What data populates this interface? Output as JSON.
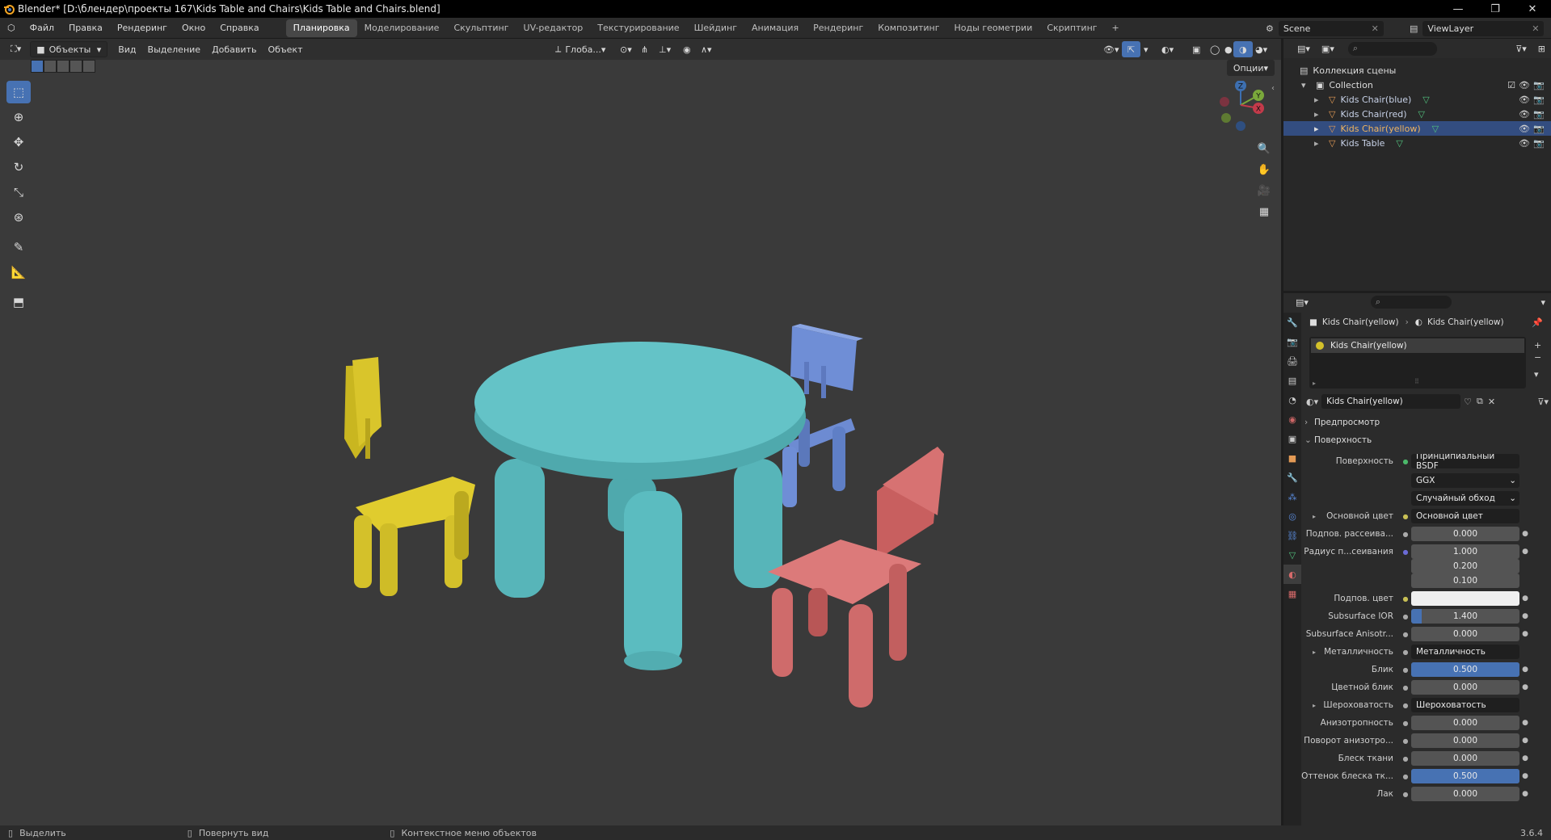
{
  "window": {
    "title": "Blender* [D:\\блендер\\проекты 167\\Kids Table and Chairs\\Kids Table and Chairs.blend]",
    "minimize": "—",
    "maximize": "❐",
    "close": "✕"
  },
  "menu": [
    "Файл",
    "Правка",
    "Рендеринг",
    "Окно",
    "Справка"
  ],
  "workspaces": [
    "Планировка",
    "Моделирование",
    "Скульптинг",
    "UV-редактор",
    "Текстурирование",
    "Шейдинг",
    "Анимация",
    "Рендеринг",
    "Композитинг",
    "Ноды геометрии",
    "Скриптинг",
    "+"
  ],
  "scene": {
    "name": "Scene",
    "view_layer": "ViewLayer"
  },
  "viewport": {
    "mode": "Объекты",
    "menus": [
      "Вид",
      "Выделение",
      "Добавить",
      "Объект"
    ],
    "transform_orientation": "Глоба...",
    "options": "Опции"
  },
  "outliner": {
    "root": "Коллекция сцены",
    "collection": "Collection",
    "items": [
      "Kids Chair(blue)",
      "Kids Chair(red)",
      "Kids Chair(yellow)",
      "Kids Table"
    ],
    "selected_index": 2
  },
  "properties": {
    "breadcrumb_object": "Kids Chair(yellow)",
    "breadcrumb_material": "Kids Chair(yellow)",
    "slot": "Kids Chair(yellow)",
    "material_name": "Kids Chair(yellow)",
    "panel_preview": "Предпросмотр",
    "panel_surface": "Поверхность",
    "surface_label": "Поверхность",
    "surface_value": "Принципиальный BSDF",
    "distribution": "GGX",
    "subsurface_method": "Случайный обход",
    "rows": [
      {
        "label": "Основной цвет",
        "value": "Основной цвет",
        "type": "link"
      },
      {
        "label": "Подпов. рассеива...",
        "value": "0.000",
        "type": "num"
      },
      {
        "label": "Радиус п...сеивания",
        "value": "1.000",
        "type": "num"
      },
      {
        "label": "",
        "value": "0.200",
        "type": "num"
      },
      {
        "label": "",
        "value": "0.100",
        "type": "num"
      },
      {
        "label": "Подпов. цвет",
        "value": "",
        "type": "color"
      },
      {
        "label": "Subsurface IOR",
        "value": "1.400",
        "type": "num",
        "fill": 0.1
      },
      {
        "label": "Subsurface Anisotr...",
        "value": "0.000",
        "type": "num"
      },
      {
        "label": "Металличность",
        "value": "Металличность",
        "type": "link"
      },
      {
        "label": "Блик",
        "value": "0.500",
        "type": "num",
        "fill": 1.0
      },
      {
        "label": "Цветной блик",
        "value": "0.000",
        "type": "num"
      },
      {
        "label": "Шероховатость",
        "value": "Шероховатость",
        "type": "link"
      },
      {
        "label": "Анизотропность",
        "value": "0.000",
        "type": "num"
      },
      {
        "label": "Поворот анизотро...",
        "value": "0.000",
        "type": "num"
      },
      {
        "label": "Блеск ткани",
        "value": "0.000",
        "type": "num"
      },
      {
        "label": "Оттенок блеска тк...",
        "value": "0.500",
        "type": "num",
        "fill": 1.0
      },
      {
        "label": "Лак",
        "value": "0.000",
        "type": "num"
      }
    ]
  },
  "status": {
    "select": "Выделить",
    "rotate": "Повернуть вид",
    "context": "Контекстное меню объектов",
    "version": "3.6.4"
  },
  "colors": {
    "accent": "#4772b3",
    "table": "#5bbcc0",
    "yellow": "#d4c12a",
    "blue": "#6f8ed6",
    "red": "#cf6b6b"
  }
}
